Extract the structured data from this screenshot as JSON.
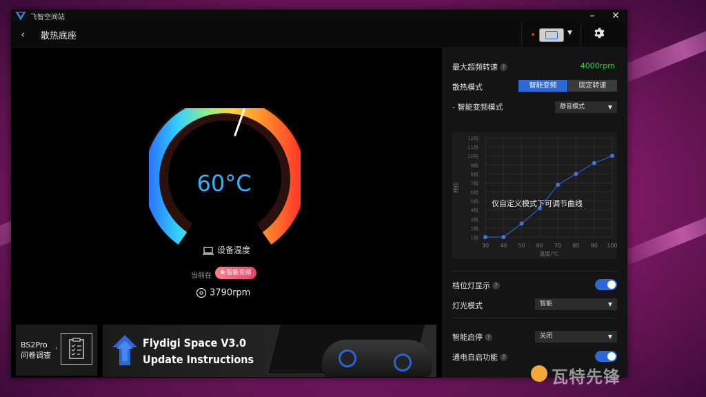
{
  "window": {
    "title": "飞智空间站"
  },
  "header": {
    "page_title": "散热底座"
  },
  "gauge": {
    "temperature": "60°C",
    "label": "设备温度",
    "current_prefix": "当前在",
    "current_mode": "智能变频",
    "fan_speed": "3790rpm",
    "colors": [
      "#2a7cff",
      "#33d0ff",
      "#9cf07a",
      "#ffd23a",
      "#ff8a2a",
      "#ff3c2a"
    ]
  },
  "survey": {
    "line1": "BS2Pro",
    "line2": "问卷调查"
  },
  "banner": {
    "line1": "Flydigi Space V3.0",
    "line2": "Update Instructions"
  },
  "settings": {
    "max_speed_label": "最大超频转速",
    "max_speed_value": "4000rpm",
    "cooling_mode_label": "散热模式",
    "cooling_modes": [
      "智能变频",
      "固定转速"
    ],
    "cooling_mode_selected": "智能变频",
    "smart_mode_label": "- 智能变频模式",
    "smart_mode_value": "静音模式",
    "curve_note": "仅自定义模式下可调节曲线",
    "gear_light_label": "档位灯显示",
    "gear_light_on": true,
    "light_mode_label": "灯光模式",
    "light_mode_value": "智能",
    "smart_stop_label": "智能启停",
    "smart_stop_value": "关闭",
    "power_on_label": "通电自启功能",
    "power_on_on": true
  },
  "chart_data": {
    "type": "line",
    "title": "",
    "xlabel": "温度/℃",
    "ylabel": "档位",
    "x_ticks": [
      30,
      40,
      50,
      60,
      70,
      80,
      90,
      100
    ],
    "y_ticks": [
      "1档",
      "2档",
      "3档",
      "4档",
      "5档",
      "6档",
      "7档",
      "8档",
      "9档",
      "10档",
      "11档",
      "12档"
    ],
    "xlim": [
      30,
      100
    ],
    "ylim": [
      1,
      12
    ],
    "grid": true,
    "series": [
      {
        "x": [
          30,
          40,
          50,
          60,
          70,
          80,
          90,
          100
        ],
        "y": [
          1,
          1,
          2.5,
          4.2,
          6.8,
          8,
          9.2,
          10
        ]
      }
    ]
  },
  "watermark": "瓦特先锋"
}
